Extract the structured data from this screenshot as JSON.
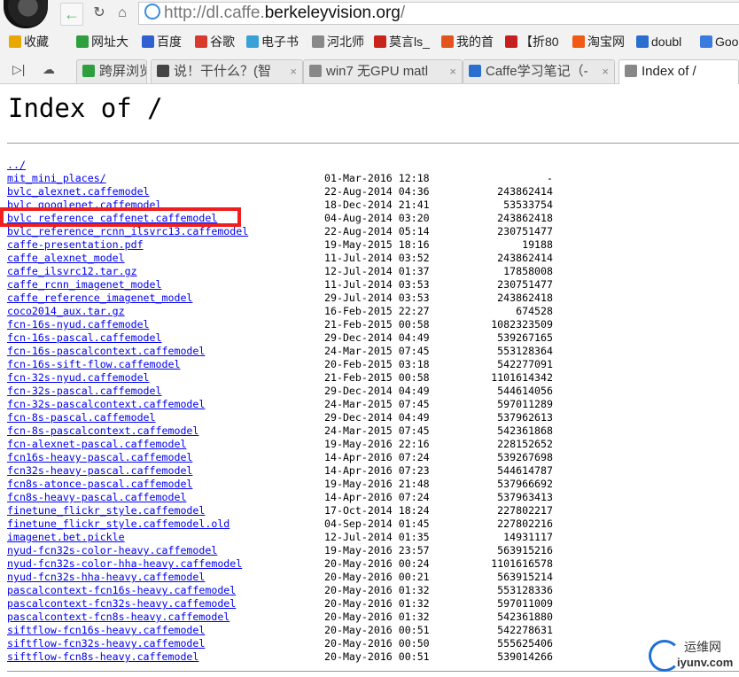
{
  "browser": {
    "url_prefix": "http://dl.caffe.",
    "url_host": "berkeleyvision.org",
    "url_suffix": "/"
  },
  "bookmarks": [
    {
      "label": "收藏",
      "icon": "star-icon",
      "color": "#e8a800"
    },
    {
      "label": "网址大",
      "icon": "site-icon",
      "color": "#2e9e3e"
    },
    {
      "label": "百度",
      "icon": "baidu-paw-icon",
      "color": "#2f5fd0"
    },
    {
      "label": "谷歌",
      "icon": "google-icon",
      "color": "#d83b2b"
    },
    {
      "label": "电子书",
      "icon": "ebook-icon",
      "color": "#3aa0d8"
    },
    {
      "label": "河北师",
      "icon": "page-icon",
      "color": "#888888"
    },
    {
      "label": "莫言ls_",
      "icon": "app-icon",
      "color": "#c8241c"
    },
    {
      "label": "我的首",
      "icon": "weibo-icon",
      "color": "#e2541b"
    },
    {
      "label": "【折80",
      "icon": "zhe80-icon",
      "color": "#c61f1f"
    },
    {
      "label": "淘宝网",
      "icon": "taobao-icon",
      "color": "#f05a14"
    },
    {
      "label": "doubl",
      "icon": "globe-icon",
      "color": "#2a6fd0"
    },
    {
      "label": "Goo",
      "icon": "translate-icon",
      "color": "#3b7be0"
    }
  ],
  "tabs": [
    {
      "label": "跨屏浏览",
      "icon": "phone-icon",
      "color": "#2e9e3e"
    },
    {
      "label": "说！干什么？(智",
      "icon": "headphones-icon",
      "color": "#444444"
    },
    {
      "label": "win7 无GPU matl",
      "icon": "page-icon",
      "color": "#888888"
    },
    {
      "label": "Caffe学习笔记（-",
      "icon": "compass-icon",
      "color": "#2a6fd0"
    },
    {
      "label": "Index of /",
      "icon": "page-icon",
      "color": "#888888"
    }
  ],
  "page": {
    "title": "Index of /"
  },
  "listing": [
    {
      "name": "../",
      "date": "",
      "size": ""
    },
    {
      "name": "mit_mini_places/",
      "date": "01-Mar-2016 12:18",
      "size": "-"
    },
    {
      "name": "bvlc_alexnet.caffemodel",
      "date": "22-Aug-2014 04:36",
      "size": "243862414"
    },
    {
      "name": "bvlc_googlenet.caffemodel",
      "date": "18-Dec-2014 21:41",
      "size": "53533754"
    },
    {
      "name": "bvlc_reference_caffenet.caffemodel",
      "date": "04-Aug-2014 03:20",
      "size": "243862418"
    },
    {
      "name": "bvlc_reference_rcnn_ilsvrc13.caffemodel",
      "date": "22-Aug-2014 05:14",
      "size": "230751477"
    },
    {
      "name": "caffe-presentation.pdf",
      "date": "19-May-2015 18:16",
      "size": "19188"
    },
    {
      "name": "caffe_alexnet_model",
      "date": "11-Jul-2014 03:52",
      "size": "243862414"
    },
    {
      "name": "caffe_ilsvrc12.tar.gz",
      "date": "12-Jul-2014 01:37",
      "size": "17858008"
    },
    {
      "name": "caffe_rcnn_imagenet_model",
      "date": "11-Jul-2014 03:53",
      "size": "230751477"
    },
    {
      "name": "caffe_reference_imagenet_model",
      "date": "29-Jul-2014 03:53",
      "size": "243862418"
    },
    {
      "name": "coco2014_aux.tar.gz",
      "date": "16-Feb-2015 22:27",
      "size": "674528"
    },
    {
      "name": "fcn-16s-nyud.caffemodel",
      "date": "21-Feb-2015 00:58",
      "size": "1082323509"
    },
    {
      "name": "fcn-16s-pascal.caffemodel",
      "date": "29-Dec-2014 04:49",
      "size": "539267165"
    },
    {
      "name": "fcn-16s-pascalcontext.caffemodel",
      "date": "24-Mar-2015 07:45",
      "size": "553128364"
    },
    {
      "name": "fcn-16s-sift-flow.caffemodel",
      "date": "20-Feb-2015 03:18",
      "size": "542277091"
    },
    {
      "name": "fcn-32s-nyud.caffemodel",
      "date": "21-Feb-2015 00:58",
      "size": "1101614342"
    },
    {
      "name": "fcn-32s-pascal.caffemodel",
      "date": "29-Dec-2014 04:49",
      "size": "544614056"
    },
    {
      "name": "fcn-32s-pascalcontext.caffemodel",
      "date": "24-Mar-2015 07:45",
      "size": "597011289"
    },
    {
      "name": "fcn-8s-pascal.caffemodel",
      "date": "29-Dec-2014 04:49",
      "size": "537962613"
    },
    {
      "name": "fcn-8s-pascalcontext.caffemodel",
      "date": "24-Mar-2015 07:45",
      "size": "542361868"
    },
    {
      "name": "fcn-alexnet-pascal.caffemodel",
      "date": "19-May-2016 22:16",
      "size": "228152652"
    },
    {
      "name": "fcn16s-heavy-pascal.caffemodel",
      "date": "14-Apr-2016 07:24",
      "size": "539267698"
    },
    {
      "name": "fcn32s-heavy-pascal.caffemodel",
      "date": "14-Apr-2016 07:23",
      "size": "544614787"
    },
    {
      "name": "fcn8s-atonce-pascal.caffemodel",
      "date": "19-May-2016 21:48",
      "size": "537966692"
    },
    {
      "name": "fcn8s-heavy-pascal.caffemodel",
      "date": "14-Apr-2016 07:24",
      "size": "537963413"
    },
    {
      "name": "finetune_flickr_style.caffemodel",
      "date": "17-Oct-2014 18:24",
      "size": "227802217"
    },
    {
      "name": "finetune_flickr_style.caffemodel.old",
      "date": "04-Sep-2014 01:45",
      "size": "227802216"
    },
    {
      "name": "imagenet.bet.pickle",
      "date": "12-Jul-2014 01:35",
      "size": "14931117"
    },
    {
      "name": "nyud-fcn32s-color-heavy.caffemodel",
      "date": "19-May-2016 23:57",
      "size": "563915216"
    },
    {
      "name": "nyud-fcn32s-color-hha-heavy.caffemodel",
      "date": "20-May-2016 00:24",
      "size": "1101616578"
    },
    {
      "name": "nyud-fcn32s-hha-heavy.caffemodel",
      "date": "20-May-2016 00:21",
      "size": "563915214"
    },
    {
      "name": "pascalcontext-fcn16s-heavy.caffemodel",
      "date": "20-May-2016 01:32",
      "size": "553128336"
    },
    {
      "name": "pascalcontext-fcn32s-heavy.caffemodel",
      "date": "20-May-2016 01:32",
      "size": "597011009"
    },
    {
      "name": "pascalcontext-fcn8s-heavy.caffemodel",
      "date": "20-May-2016 01:32",
      "size": "542361880"
    },
    {
      "name": "siftflow-fcn16s-heavy.caffemodel",
      "date": "20-May-2016 00:51",
      "size": "542278631"
    },
    {
      "name": "siftflow-fcn32s-heavy.caffemodel",
      "date": "20-May-2016 00:50",
      "size": "555625406"
    },
    {
      "name": "siftflow-fcn8s-heavy.caffemodel",
      "date": "20-May-2016 00:51",
      "size": "539014266"
    }
  ],
  "watermark": {
    "cn": "运维网",
    "en": "iyunv.com"
  },
  "colors": {
    "link": "#0000ee",
    "highlight": "#f01e1e"
  }
}
